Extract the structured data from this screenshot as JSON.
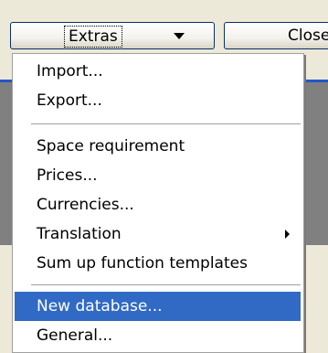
{
  "toolbar": {
    "extras_label": "Extras",
    "close_label": "Close"
  },
  "menu": {
    "items": [
      {
        "label": "Import..."
      },
      {
        "label": "Export..."
      },
      {
        "label": "Space requirement"
      },
      {
        "label": "Prices..."
      },
      {
        "label": "Currencies..."
      },
      {
        "label": "Translation",
        "has_submenu": true
      },
      {
        "label": "Sum up function templates"
      },
      {
        "label": "New database...",
        "highlighted": true
      },
      {
        "label": "General..."
      }
    ]
  },
  "colors": {
    "highlight": "#316ac5",
    "accent_line": "#2456c8",
    "panel_gray": "#808080",
    "window_bg": "#ece9d8"
  }
}
